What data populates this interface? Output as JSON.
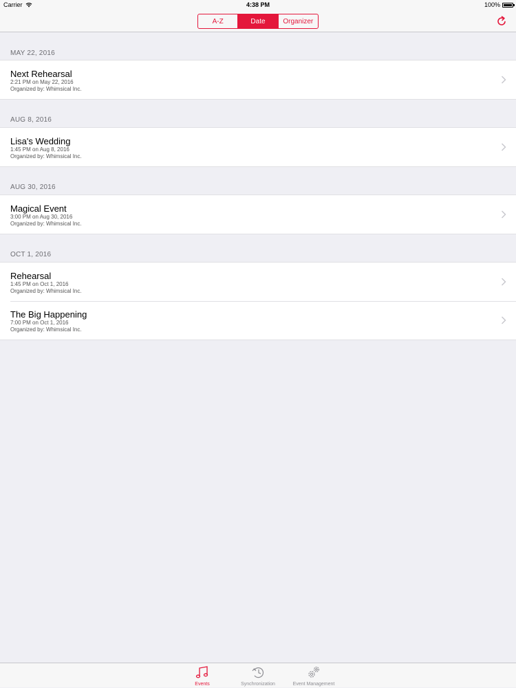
{
  "status_bar": {
    "carrier": "Carrier",
    "time": "4:38 PM",
    "battery": "100%"
  },
  "nav": {
    "segments": [
      "A-Z",
      "Date",
      "Organizer"
    ],
    "selected_segment": "Date"
  },
  "colors": {
    "accent": "#e4173b",
    "background": "#efeff4"
  },
  "sections": [
    {
      "header": "MAY 22, 2016",
      "events": [
        {
          "title": "Next Rehearsal",
          "time": "2:21 PM on May 22, 2016",
          "organizer": "Organized by: Whimsical Inc."
        }
      ]
    },
    {
      "header": "AUG 8, 2016",
      "events": [
        {
          "title": "Lisa's Wedding",
          "time": "1:45 PM on Aug 8, 2016",
          "organizer": "Organized by: Whimsical Inc."
        }
      ]
    },
    {
      "header": "AUG 30, 2016",
      "events": [
        {
          "title": "Magical Event",
          "time": "3:00 PM on Aug 30, 2016",
          "organizer": "Organized by: Whimsical Inc."
        }
      ]
    },
    {
      "header": "OCT 1, 2016",
      "events": [
        {
          "title": "Rehearsal",
          "time": "1:45 PM on Oct 1, 2016",
          "organizer": "Organized by: Whimsical Inc."
        },
        {
          "title": "The Big Happening",
          "time": "7:00 PM on Oct 1, 2016",
          "organizer": "Organized by: Whimsical Inc."
        }
      ]
    }
  ],
  "tabs": [
    {
      "label": "Events",
      "icon": "music-note-icon",
      "active": true
    },
    {
      "label": "Synchronization",
      "icon": "sync-clock-icon",
      "active": false
    },
    {
      "label": "Event Management",
      "icon": "gears-icon",
      "active": false
    }
  ]
}
